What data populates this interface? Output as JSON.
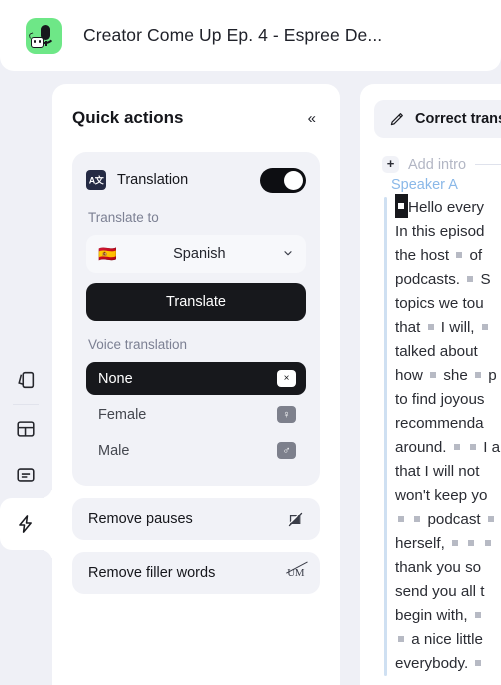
{
  "header": {
    "title": "Creator Come Up Ep. 4 - Espree De...",
    "app_icon": "microphone-robot-icon",
    "icon_bg": "#6ee787"
  },
  "rail": {
    "items": [
      {
        "name": "media-cards",
        "icon": "cards-stack-icon",
        "active": false
      },
      {
        "name": "layout",
        "icon": "layout-panels-icon",
        "active": false
      },
      {
        "name": "subtitles",
        "icon": "subtitle-box-icon",
        "active": false
      },
      {
        "name": "quick-actions",
        "icon": "lightning-bolt-icon",
        "active": true
      }
    ]
  },
  "quick_actions": {
    "title": "Quick actions",
    "collapse_icon": "«",
    "translation": {
      "label": "Translation",
      "icon": "translate-icon",
      "icon_text": "A文",
      "enabled": true,
      "translate_to_label": "Translate to",
      "language_flag": "🇪🇸",
      "language": "Spanish",
      "chevron": "⌄",
      "translate_button": "Translate"
    },
    "voice_translation": {
      "label": "Voice translation",
      "options": [
        {
          "label": "None",
          "badge": "×",
          "selected": true
        },
        {
          "label": "Female",
          "badge": "♀",
          "selected": false
        },
        {
          "label": "Male",
          "badge": "♂",
          "selected": false
        }
      ]
    },
    "actions": [
      {
        "label": "Remove pauses",
        "icon": "pause-slash-icon"
      },
      {
        "label": "Remove filler words",
        "icon": "um-slash-icon",
        "glyph": "UM"
      }
    ]
  },
  "transcript": {
    "correct_button": "Correct trans",
    "correct_icon": "pencil-icon",
    "add_intro": "Add intro",
    "add_icon": "plus-icon",
    "speaker": "Speaker A",
    "lines": [
      "Hello every",
      "In this episod",
      "the host ▪ of",
      "podcasts. ▪ S",
      "topics we tou",
      "that ▪ I will, ▪",
      "talked about",
      "how ▪ she ▪ p",
      "to find joyous",
      "recommenda",
      "around. ▪ ▪ I a",
      "that I will not",
      "won't keep yo",
      "▪ ▪ podcast ▪",
      "herself, ▪ ▪ ▪",
      "thank you so",
      "send you all t",
      "begin with, ▪",
      "▪ a nice little",
      "everybody. ▪"
    ]
  },
  "colors": {
    "page_bg": "#eff0f6",
    "panel_bg": "#ffffff",
    "card_bg": "#f1f2f7",
    "dark": "#17181c",
    "speaker_blue": "#8ab8e8",
    "muted": "#7c8093"
  }
}
